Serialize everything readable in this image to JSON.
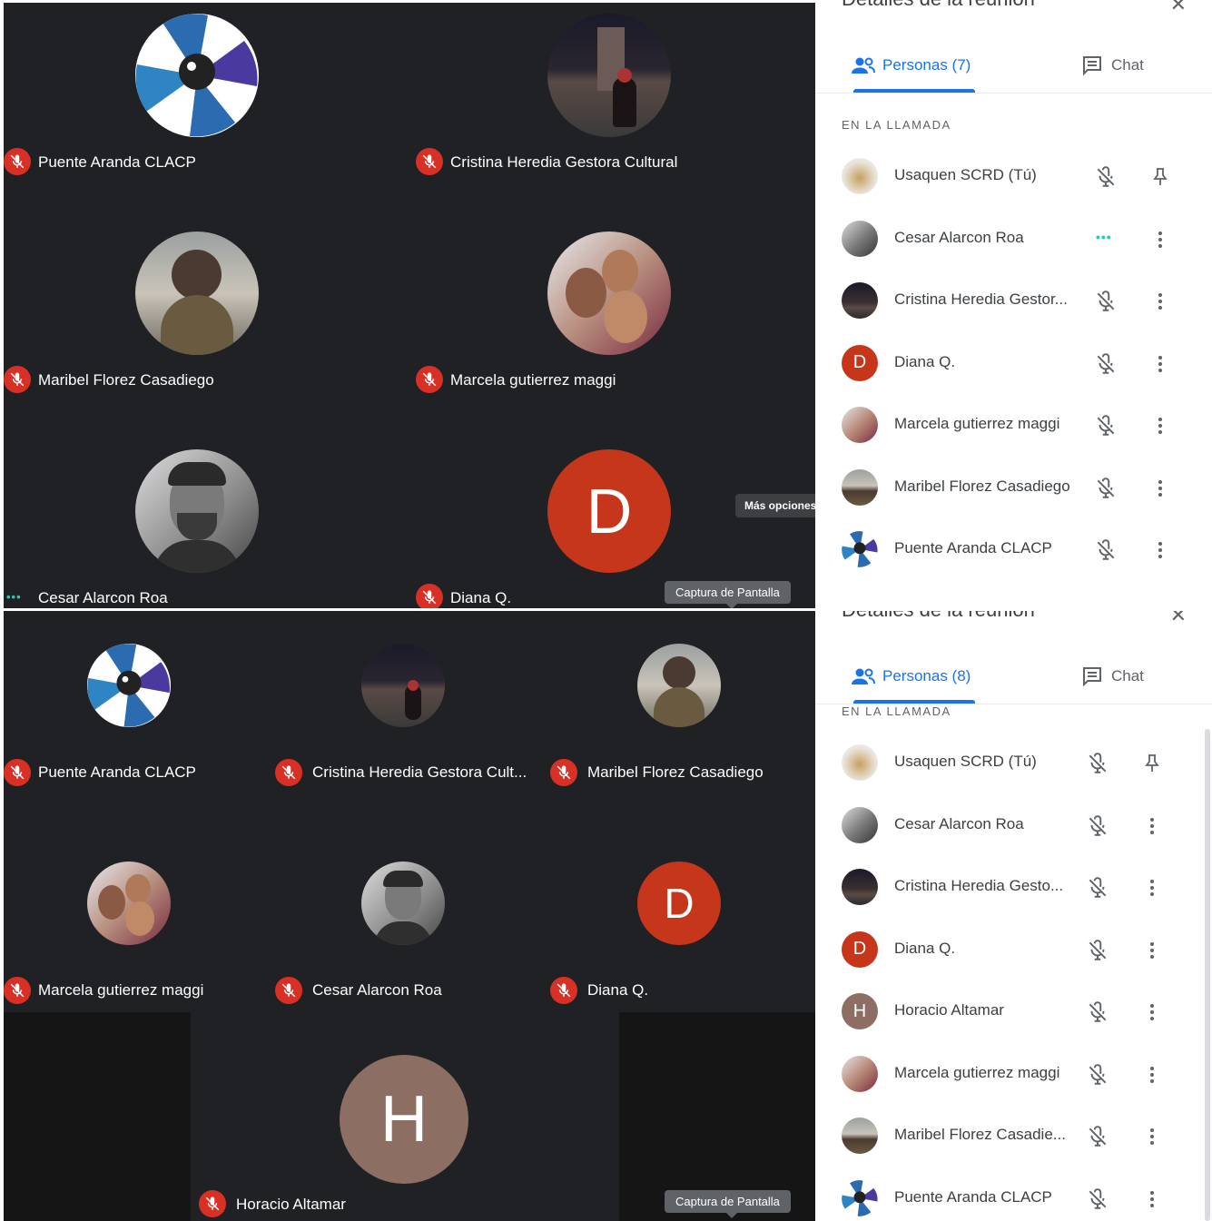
{
  "mic_off_label": "mic-off",
  "colors": {
    "stage": "#202124",
    "muted_red": "#d93025",
    "accent_blue": "#1a73e8",
    "speaking_teal": "#2fc5b0",
    "diana_orange": "#c5361b",
    "horacio_brown": "#8d6e63"
  },
  "top": {
    "tiles": [
      {
        "name": "Puente Aranda CLACP",
        "status": "muted",
        "avatar": "logo"
      },
      {
        "name": "Cristina Heredia Gestora Cultural",
        "status": "muted",
        "avatar": "photo-night"
      },
      {
        "name": "Maribel Florez Casadiego",
        "status": "muted",
        "avatar": "photo-beach"
      },
      {
        "name": "Marcela gutierrez maggi",
        "status": "muted",
        "avatar": "photo-selfie"
      },
      {
        "name": "Cesar Alarcon Roa",
        "status": "speaking",
        "avatar": "photo-man"
      },
      {
        "name": "Diana Q.",
        "status": "muted",
        "avatar": "letter",
        "letter": "D"
      }
    ],
    "speaking_dots": "•••",
    "tooltip_more": "Más opciones",
    "tooltip_capture": "Captura de Pantalla",
    "panel": {
      "title": "Detalles de la reunión",
      "tab_people": "Personas (7)",
      "tab_chat": "Chat",
      "section": "EN LA LLAMADA",
      "people": [
        {
          "name": "Usaquen SCRD (Tú)",
          "avatar": "photo-usaquen",
          "action": "pin"
        },
        {
          "name": "Cesar Alarcon Roa",
          "avatar": "photo-man",
          "action": "more",
          "speaking": true
        },
        {
          "name": "Cristina Heredia Gestor...",
          "avatar": "photo-night",
          "action": "more"
        },
        {
          "name": "Diana Q.",
          "avatar": "letter",
          "letter": "D",
          "action": "more"
        },
        {
          "name": "Marcela gutierrez maggi",
          "avatar": "photo-selfie",
          "action": "more"
        },
        {
          "name": "Maribel Florez Casadiego",
          "avatar": "photo-beach",
          "action": "more"
        },
        {
          "name": "Puente Aranda CLACP",
          "avatar": "logo",
          "action": "more"
        }
      ]
    }
  },
  "bottom": {
    "tiles": [
      {
        "name": "Puente Aranda CLACP",
        "status": "muted",
        "avatar": "logo"
      },
      {
        "name": "Cristina Heredia Gestora Cult...",
        "status": "muted",
        "avatar": "photo-night"
      },
      {
        "name": "Maribel Florez Casadiego",
        "status": "muted",
        "avatar": "photo-beach"
      },
      {
        "name": "Marcela gutierrez maggi",
        "status": "muted",
        "avatar": "photo-selfie"
      },
      {
        "name": "Cesar Alarcon Roa",
        "status": "muted",
        "avatar": "photo-man"
      },
      {
        "name": "Diana Q.",
        "status": "muted",
        "avatar": "letter",
        "letter": "D"
      },
      {
        "name": "Horacio Altamar",
        "status": "muted",
        "avatar": "letter",
        "letter": "H"
      }
    ],
    "tooltip_capture": "Captura de Pantalla",
    "panel": {
      "title": "Detalles de la reunión",
      "tab_people": "Personas (8)",
      "tab_chat": "Chat",
      "section": "EN LA LLAMADA",
      "people": [
        {
          "name": "Usaquen SCRD (Tú)",
          "avatar": "photo-usaquen",
          "action": "pin"
        },
        {
          "name": "Cesar Alarcon Roa",
          "avatar": "photo-man",
          "action": "more"
        },
        {
          "name": "Cristina Heredia Gesto...",
          "avatar": "photo-night",
          "action": "more"
        },
        {
          "name": "Diana Q.",
          "avatar": "letter",
          "letter": "D",
          "action": "more"
        },
        {
          "name": "Horacio Altamar",
          "avatar": "letter",
          "letter": "H",
          "action": "more"
        },
        {
          "name": "Marcela gutierrez maggi",
          "avatar": "photo-selfie",
          "action": "more"
        },
        {
          "name": "Maribel Florez Casadie...",
          "avatar": "photo-beach",
          "action": "more"
        },
        {
          "name": "Puente Aranda CLACP",
          "avatar": "logo",
          "action": "more"
        }
      ]
    }
  }
}
